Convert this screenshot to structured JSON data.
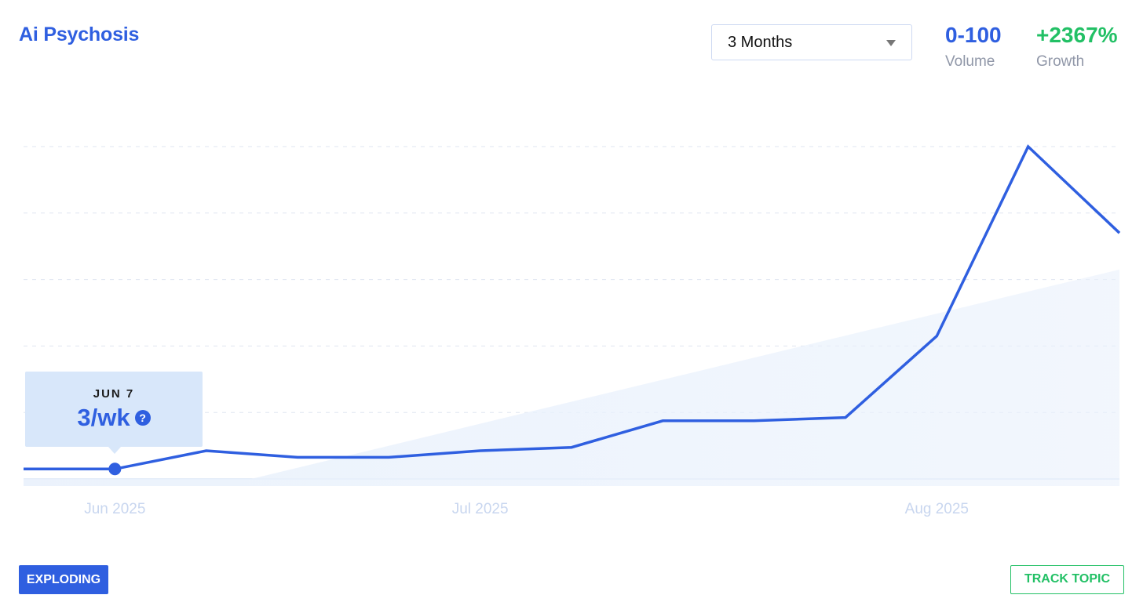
{
  "header": {
    "title": "Ai Psychosis"
  },
  "range_select": {
    "value": "3 Months"
  },
  "stats": {
    "volume": {
      "value": "0-100",
      "label": "Volume"
    },
    "growth": {
      "value": "+2367%",
      "label": "Growth"
    }
  },
  "tooltip": {
    "date": "JUN 7",
    "value": "3/wk",
    "help_glyph": "?"
  },
  "footer": {
    "badge": "EXPLODING",
    "track_button": "TRACK TOPIC"
  },
  "colors": {
    "accent": "#2f5fe0",
    "growth": "#22c065",
    "tooltip_bg": "#d8e7fa",
    "trend_fill": "#e9f1fc",
    "grid": "#dfe5f0"
  },
  "chart_data": {
    "type": "line",
    "title": "",
    "xlabel": "",
    "ylabel": "",
    "x_tick_labels": [
      "Jun 2025",
      "Jul 2025",
      "Aug 2025"
    ],
    "x": [
      "2025-05-31",
      "2025-06-07",
      "2025-06-14",
      "2025-06-21",
      "2025-06-28",
      "2025-07-05",
      "2025-07-12",
      "2025-07-19",
      "2025-07-26",
      "2025-08-02",
      "2025-08-09",
      "2025-08-16",
      "2025-08-23"
    ],
    "series": [
      {
        "values": [
          3,
          3,
          8.5,
          6.5,
          6.5,
          8.5,
          9.5,
          17.5,
          17.5,
          18.5,
          43,
          100,
          74
        ]
      }
    ],
    "trend": {
      "start": 0,
      "end": 63
    },
    "ylim": [
      0,
      100
    ],
    "highlight_index": 1,
    "grid": true
  }
}
